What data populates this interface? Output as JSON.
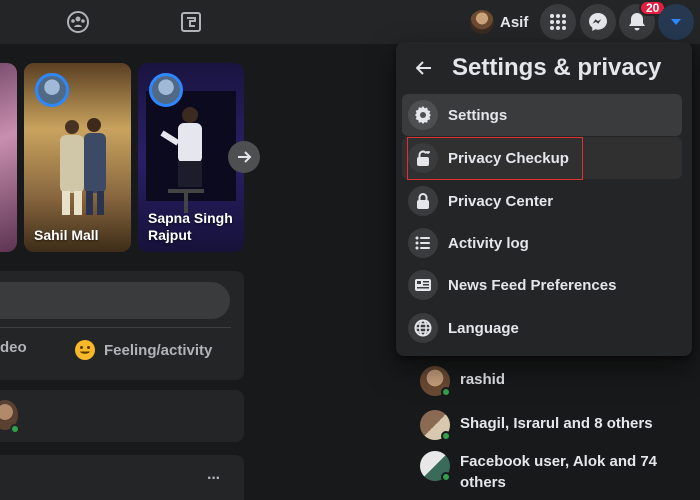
{
  "topbar": {
    "profile_name": "Asif",
    "notification_count": "20"
  },
  "stories": [
    {
      "label": ""
    },
    {
      "label": "Sahil Mall"
    },
    {
      "label": "Sapna Singh Rajput"
    }
  ],
  "composer": {
    "video_label": "deo",
    "feeling_label": "Feeling/activity"
  },
  "post_menu": "···",
  "settings_menu": {
    "title": "Settings & privacy",
    "items": [
      {
        "label": "Settings",
        "icon": "gear-icon"
      },
      {
        "label": "Privacy Checkup",
        "icon": "lock-icon"
      },
      {
        "label": "Privacy Center",
        "icon": "lock-icon"
      },
      {
        "label": "Activity log",
        "icon": "list-icon"
      },
      {
        "label": "News Feed Preferences",
        "icon": "feed-icon"
      },
      {
        "label": "Language",
        "icon": "globe-icon"
      }
    ]
  },
  "contacts": [
    {
      "name": "rashid"
    },
    {
      "name": "Shagil, Israrul and 8 others"
    },
    {
      "name": "Facebook user, Alok and 74 others"
    }
  ],
  "colors": {
    "accent": "#2d88ff",
    "online": "#31a24c",
    "badge": "#e41e3f",
    "highlight": "#e0312f"
  }
}
